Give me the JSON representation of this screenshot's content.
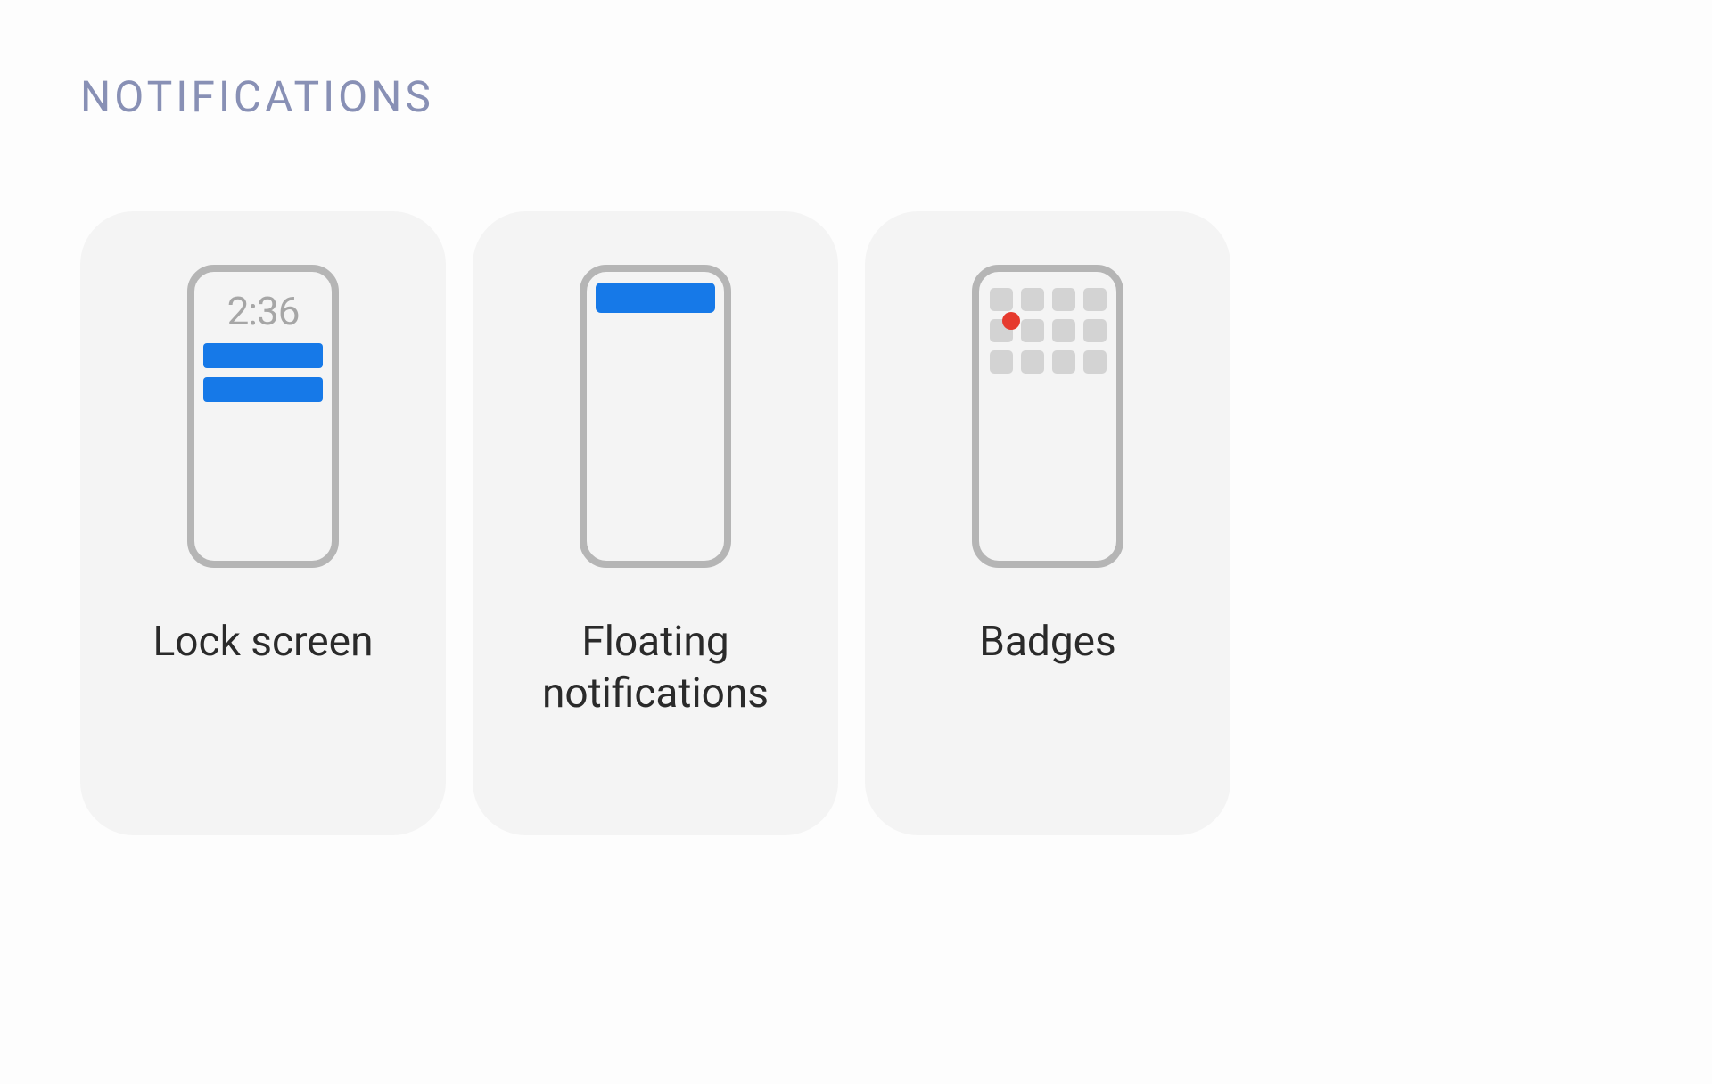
{
  "section": {
    "title": "NOTIFICATIONS"
  },
  "cards": {
    "lockscreen": {
      "label": "Lock screen",
      "time": "2:36"
    },
    "floating": {
      "label": "Floating notifications"
    },
    "badges": {
      "label": "Badges"
    }
  },
  "colors": {
    "accent": "#1679e8",
    "badge": "#e63a2e",
    "heading": "#8890b5",
    "cardBg": "#f4f4f4",
    "phoneBorder": "#b5b5b5"
  }
}
